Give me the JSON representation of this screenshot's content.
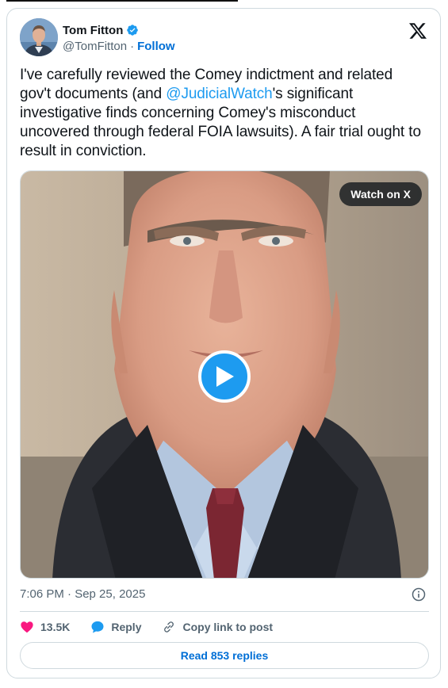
{
  "author": {
    "display_name": "Tom Fitton",
    "handle": "@TomFitton",
    "separator": "·",
    "follow_label": "Follow",
    "verified": true
  },
  "tweet": {
    "text_before_mention": "I've carefully reviewed the Comey indictment and related gov't documents (and ",
    "mention": "@JudicialWatch",
    "text_after_mention": "'s significant investigative finds concerning Comey's misconduct uncovered through federal FOIA lawsuits).  A fair trial ought to result in conviction."
  },
  "media": {
    "type": "video",
    "watch_label": "Watch on X"
  },
  "timestamp": "7:06 PM · Sep 25, 2025",
  "actions": {
    "likes": "13.5K",
    "reply_label": "Reply",
    "copy_link_label": "Copy link to post"
  },
  "read_replies_label": "Read 853 replies",
  "colors": {
    "accent": "#1d9bf0",
    "link": "#006fd6",
    "like": "#f91880",
    "muted": "#536471",
    "border": "#cfd9de"
  },
  "icons": {
    "verified": "verified-badge-icon",
    "logo": "x-logo-icon",
    "info": "info-icon",
    "like": "heart-icon",
    "reply": "speech-bubble-icon",
    "copy": "link-icon",
    "play": "play-icon"
  }
}
